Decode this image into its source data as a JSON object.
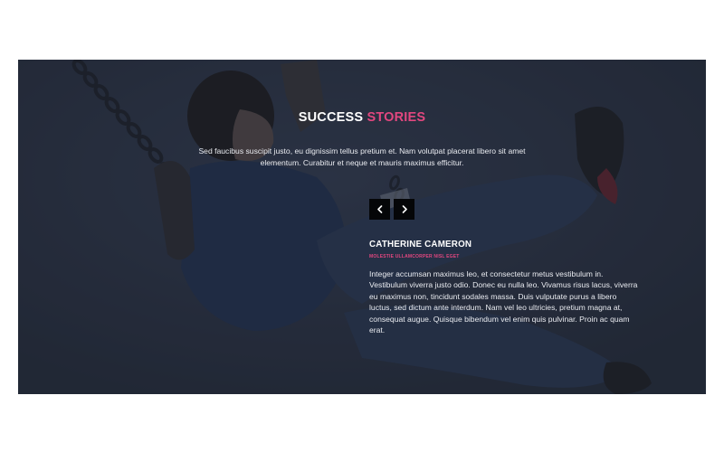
{
  "section": {
    "heading_main": "SUCCESS",
    "heading_accent": "STORIES",
    "intro": "Sed faucibus suscipit justo, eu dignissim tellus pretium et. Nam volutpat placerat libero sit amet elementum. Curabitur et neque et mauris maximus efficitur."
  },
  "slider": {
    "prev_icon": "chevron-left-icon",
    "next_icon": "chevron-right-icon"
  },
  "testimonial": {
    "name": "CATHERINE CAMERON",
    "role": "MOLESTIE ULLAMCORPER NISL EGET",
    "quote": "Integer accumsan maximus leo, et consectetur metus vestibulum in. Vestibulum viverra justo odio. Donec eu nulla leo. Vivamus risus lacus, viverra eu maximus non, tincidunt sodales massa. Duis vulputate purus a libero luctus, sed dictum ante interdum. Nam vel leo ultricies, pretium magna at, consequat augue. Quisque bibendum vel enim quis pulvinar. Proin ac quam erat."
  },
  "colors": {
    "accent": "#e2477f",
    "overlay": "#2a3142",
    "button": "#050608"
  }
}
